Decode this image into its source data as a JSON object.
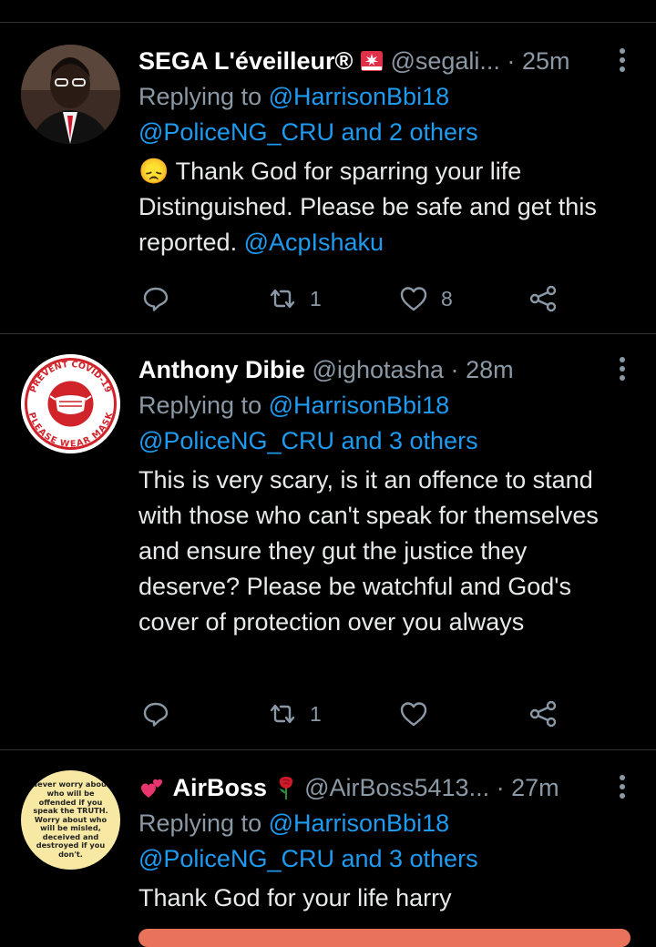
{
  "tweets": [
    {
      "name": "SEGA L'éveilleur®",
      "handle": "@segali...",
      "dot": "·",
      "time": "25m",
      "reply_prefix": "Replying to",
      "reply_user": "@HarrisonBbi18",
      "reply_others": "@PoliceNG_CRU and 2 others",
      "emoji": "😞",
      "text_before": "Thank God for sparring your life Distinguished. Please be safe and get this reported.",
      "mention": "@AcpIshaku",
      "retweets": "1",
      "likes": "8"
    },
    {
      "name": "Anthony Dibie",
      "handle": "@ighotasha",
      "dot": "·",
      "time": "28m",
      "reply_prefix": "Replying to",
      "reply_user": "@HarrisonBbi18",
      "reply_others": "@PoliceNG_CRU and 3 others",
      "text": "This is very scary, is it an offence to stand with those who can't speak for themselves and ensure they gut the justice they deserve? Please be watchful and God's cover of protection over you always",
      "avatar_text_top": "PREVENT COVID-19",
      "avatar_text_bottom": "PLEASE WEAR MASK",
      "retweets": "1",
      "likes": ""
    },
    {
      "name": "AirBoss",
      "handle": "@AirBoss5413...",
      "dot": "·",
      "time": "27m",
      "reply_prefix": "Replying to",
      "reply_user": "@HarrisonBbi18",
      "reply_others": "@PoliceNG_CRU and 3 others",
      "text": "Thank God for your life harry",
      "avatar_text": "Never worry about who will be offended if you speak the TRUTH. Worry about who will be misled, deceived and destroyed if you don't."
    }
  ],
  "colors": {
    "link": "#1d9bf0",
    "muted": "#8b98a5",
    "bg": "#000000"
  },
  "icons": [
    "reply-icon",
    "retweet-icon",
    "like-icon",
    "share-icon",
    "more-icon"
  ]
}
